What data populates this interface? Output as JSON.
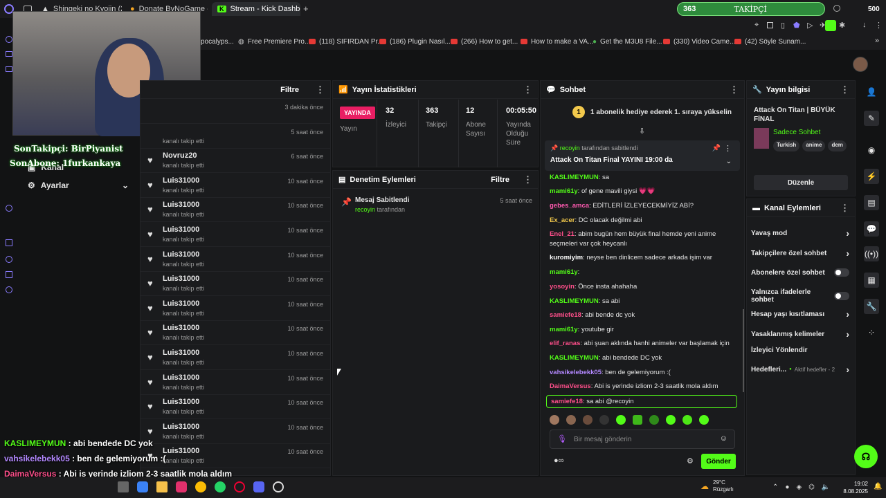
{
  "browser": {
    "tabs": [
      "Shingeki no Kyojin (2013)",
      "Donate ByNoGame - Ge",
      "Stream - Kick Dashboard"
    ],
    "new_tab": "+",
    "follower_pill": {
      "count": "363",
      "label": "TAKİPÇİ",
      "right_count": "500"
    }
  },
  "bookmarks": [
    "pocalyps...",
    "Free Premiere Pro...",
    "(118) SIFIRDAN Pr...",
    "(186) Plugin Nasıl...",
    "(266) How to get...",
    "How to make a VA...",
    "Get the M3U8 File...",
    "(330) Video Came...",
    "(42) Söyle Sunam..."
  ],
  "left_nav": {
    "items": [
      {
        "label": "Kanal"
      },
      {
        "label": "Ayarlar"
      }
    ]
  },
  "followers": {
    "filter_label": "Filtre",
    "rows": [
      {
        "name": "",
        "sub": "",
        "time": "3 dakika önce"
      },
      {
        "name": "",
        "sub": "kanalı takip etti",
        "time": "5 saat önce"
      },
      {
        "name": "Novruz20",
        "sub": "kanalı takip etti",
        "time": "6 saat önce"
      },
      {
        "name": "Luis31000",
        "sub": "kanalı takip etti",
        "time": "10 saat önce"
      },
      {
        "name": "Luis31000",
        "sub": "kanalı takip etti",
        "time": "10 saat önce"
      },
      {
        "name": "Luis31000",
        "sub": "kanalı takip etti",
        "time": "10 saat önce"
      },
      {
        "name": "Luis31000",
        "sub": "kanalı takip etti",
        "time": "10 saat önce"
      },
      {
        "name": "Luis31000",
        "sub": "kanalı takip etti",
        "time": "10 saat önce"
      },
      {
        "name": "Luis31000",
        "sub": "kanalı takip etti",
        "time": "10 saat önce"
      },
      {
        "name": "Luis31000",
        "sub": "kanalı takip etti",
        "time": "10 saat önce"
      },
      {
        "name": "Luis31000",
        "sub": "kanalı takip etti",
        "time": "10 saat önce"
      },
      {
        "name": "Luis31000",
        "sub": "kanalı takip etti",
        "time": "10 saat önce"
      },
      {
        "name": "Luis31000",
        "sub": "kanalı takip etti",
        "time": "10 saat önce"
      },
      {
        "name": "Luis31000",
        "sub": "kanalı takip etti",
        "time": "10 saat önce"
      },
      {
        "name": "Luis31000",
        "sub": "kanalı takip etti",
        "time": "10 saat önce"
      }
    ]
  },
  "stats": {
    "title": "Yayın İstatistikleri",
    "live_badge": "YAYINDA",
    "live_label": "Yayın",
    "items": [
      {
        "value": "32",
        "label": "İzleyici"
      },
      {
        "value": "363",
        "label": "Takipçi"
      },
      {
        "value": "12",
        "label": "Abone Sayısı"
      },
      {
        "value": "00:05:50",
        "label": "Yayında Olduğu Süre"
      }
    ]
  },
  "moderation": {
    "title": "Denetim Eylemleri",
    "filter_label": "Filtre",
    "item": {
      "title": "Mesaj Sabitlendi",
      "by_user": "recoyin",
      "by_suffix": "tarafından",
      "time": "5 saat önce"
    }
  },
  "chat": {
    "title": "Sohbet",
    "gift_banner": "1 abonelik hediye ederek 1. sıraya yükselin",
    "gift_rank": "1",
    "pinned": {
      "by_user": "recoyin",
      "by_suffix": "tarafından sabitlendi",
      "text": "Attack On Titan Final YAYINI 19:00 da"
    },
    "messages": [
      {
        "user": "KASLIMEYMUN",
        "text": "sa",
        "color": "#53fc18"
      },
      {
        "user": "mami61y",
        "text": "of gene mavili giysi 💗💗",
        "color": "#53fc18"
      },
      {
        "user": "gebes_amca",
        "text": "EDİTLERİ İZLEYECEKMİYİZ ABİ?",
        "color": "#ff5ab0"
      },
      {
        "user": "Ex_acer",
        "text": "DC olacak değilmi abi",
        "color": "#f2c94c"
      },
      {
        "user": "Enel_21",
        "text": "abim bugün hem büyük final hemde yeni anime",
        "color": "#ff4f8b"
      },
      {
        "user": "",
        "text": "seçmeleri var çok heycanlı",
        "color": "#ffffff"
      },
      {
        "user": "kuromiyim",
        "text": "neyse ben dinlicem sadece arkada işim var",
        "color": "#ffffff"
      },
      {
        "user": "mami61y",
        "text": "",
        "color": "#53fc18"
      },
      {
        "user": "yosoyin",
        "text": "Önce insta ahahaha",
        "color": "#ff4f8b"
      },
      {
        "user": "KASLIMEYMUN",
        "text": "sa abi",
        "color": "#53fc18"
      },
      {
        "user": "samiefe18",
        "text": "abi bende dc yok",
        "color": "#ff4f8b"
      },
      {
        "user": "mami61y",
        "text": "youtube gir",
        "color": "#53fc18"
      },
      {
        "user": "elif_ranas",
        "text": "abi şuan aklında hanhi animeler var başlamak için",
        "color": "#ff4f8b"
      },
      {
        "user": "KASLIMEYMUN",
        "text": "abi bendede DC yok",
        "color": "#53fc18"
      },
      {
        "user": "vahsikelebekk05",
        "text": "ben de gelemiyorum :(",
        "color": "#b388ff"
      },
      {
        "user": "DaimaVersus",
        "text": "Abi is yerinde izliom 2-3 saatlik mola aldım",
        "color": "#ff4f8b"
      },
      {
        "user": "samiefe18",
        "text": "sa abi @recoyin",
        "color": "#ff4f8b"
      }
    ],
    "input_placeholder": "Bir mesaj gönderin",
    "send_label": "Gönder"
  },
  "stream_info": {
    "title_label": "Yayın bilgisi",
    "stream_title": "Attack On Titan | BÜYÜK FİNAL",
    "category": "Sadece Sohbet",
    "tags": [
      "Turkish",
      "anime",
      "dem"
    ],
    "edit_label": "Düzenle"
  },
  "channel_actions": {
    "title": "Kanal Eylemleri",
    "items": [
      {
        "label": "Yavaş mod",
        "kind": "arrow"
      },
      {
        "label": "Takipçilere özel sohbet",
        "kind": "arrow"
      },
      {
        "label": "Abonelere özel sohbet",
        "kind": "toggle"
      },
      {
        "label": "Yalnızca ifadelerle sohbet",
        "kind": "toggle"
      },
      {
        "label": "Hesap yaşı kısıtlaması",
        "kind": "arrow"
      },
      {
        "label": "Yasaklanmış kelimeler",
        "kind": "arrow"
      },
      {
        "label": "İzleyici Yönlendir",
        "kind": "none"
      },
      {
        "label": "Hedefleri...",
        "kind": "arrow",
        "extra": "Aktif hedefler - 2"
      }
    ]
  },
  "overlay": {
    "last_follow": "SonTakipçi: BirPiyanist",
    "last_sub": "SonAbone: 1furkankaya",
    "chat_lines": [
      {
        "user": "KASLIMEYMUN",
        "text": ": abi bendede DC yok"
      },
      {
        "user": "vahsikelebekk05",
        "text": ": ben de gelemiyorum :("
      },
      {
        "user": "DaimaVersus",
        "text": ": Abi is yerinde izliom 2-3 saatlik mola aldım"
      },
      {
        "user": "samiefe18",
        "text": ": sa abi @recoyin"
      }
    ]
  },
  "taskbar": {
    "weather_temp": "29°C",
    "weather_label": "Rüzgarlı",
    "time": "19:02",
    "date": "8.08.2025"
  }
}
